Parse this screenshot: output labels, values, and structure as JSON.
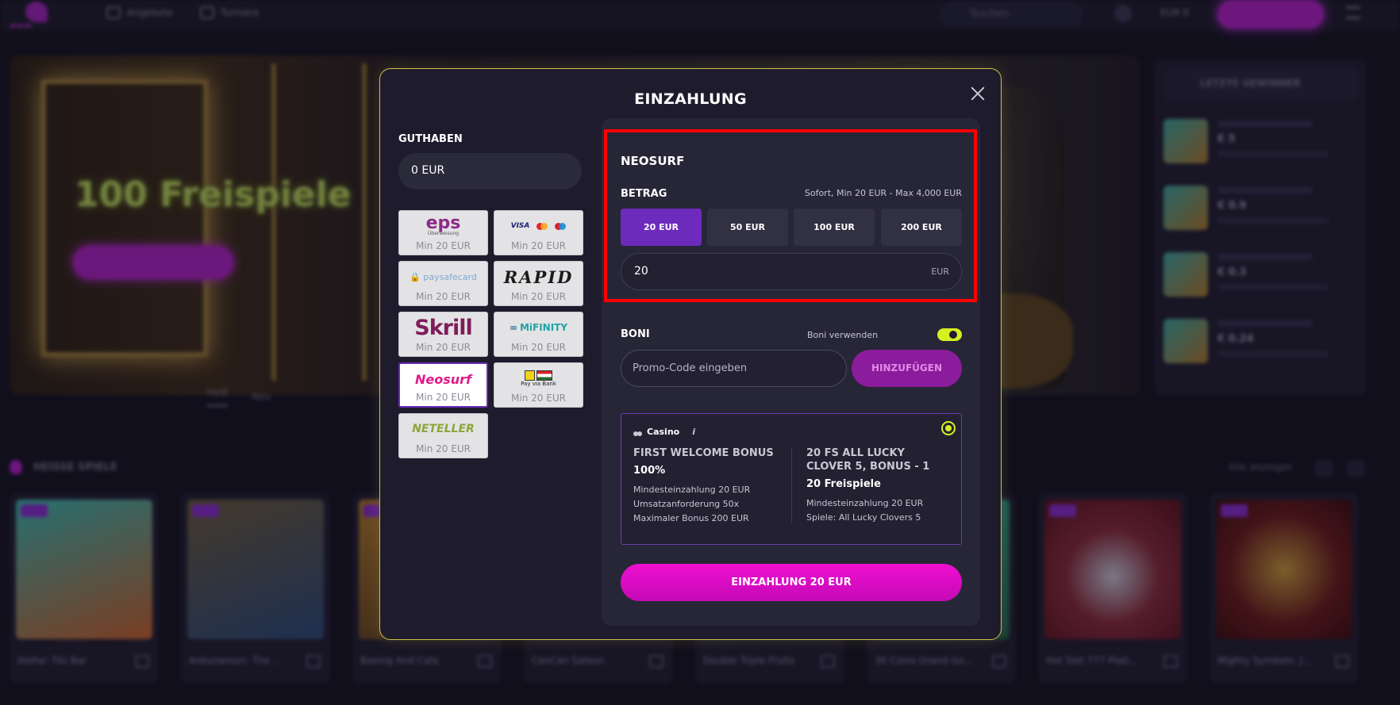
{
  "background": {
    "nav": {
      "offers": "Angebote",
      "tournaments": "Turniere"
    },
    "search_placeholder": "Suchen",
    "balance": "EUR 0",
    "hero_title": "100 Freispiele",
    "hero_tabs": [
      "Heiß",
      "Neu"
    ],
    "winners_title": "LETZTE GEWINNER",
    "winners": [
      "€ 5",
      "€ 0.9",
      "€ 0.3",
      "€ 0.24"
    ],
    "hot_games_title": "HEISSE SPIELE",
    "show_all": "Alle anzeigen",
    "games": [
      "Aloha! Tiki Bar",
      "Ankunamun: The ...",
      "Boxing And Cats",
      "CanCan Saloon",
      "Double Triple Fruits",
      "30 Coins Grand Go...",
      "Hot Slot 777 Plati...",
      "Mighty Symbols: J..."
    ]
  },
  "modal": {
    "title": "EINZAHLUNG",
    "balance_label": "GUTHABEN",
    "balance_value": "0 EUR",
    "methods": [
      {
        "name": "eps",
        "min": "Min 20 EUR"
      },
      {
        "name": "Visa Mastercard Maestro",
        "min": "Min 20 EUR"
      },
      {
        "name": "paysafecard",
        "min": "Min 20 EUR"
      },
      {
        "name": "RAPID",
        "min": "Min 20 EUR"
      },
      {
        "name": "Skrill",
        "min": "Min 20 EUR"
      },
      {
        "name": "MiFINITY",
        "min": "Min 20 EUR"
      },
      {
        "name": "Neosurf",
        "min": "Min 20 EUR",
        "selected": true
      },
      {
        "name": "Pay via Bank",
        "min": "Min 20 EUR"
      },
      {
        "name": "NETELLER",
        "min": "Min 20 EUR"
      }
    ],
    "selected_method_title": "NEOSURF",
    "amount_label": "BETRAG",
    "amount_info": "Sofort, Min 20 EUR - Max 4,000 EUR",
    "amount_options": [
      "20 EUR",
      "50 EUR",
      "100 EUR",
      "200 EUR"
    ],
    "amount_value": "20",
    "amount_currency": "EUR",
    "bonus_label": "BONI",
    "bonus_toggle_label": "Boni verwenden",
    "bonus_toggle_on": true,
    "promo_placeholder": "Promo-Code eingeben",
    "add_button": "HINZUFÜGEN",
    "bonus_card": {
      "category": "Casino",
      "info": "i",
      "left": {
        "name": "FIRST WELCOME BONUS",
        "value": "100%",
        "lines": [
          "Mindesteinzahlung 20 EUR",
          "Umsatzanforderung 50x",
          "Maximaler Bonus 200 EUR"
        ]
      },
      "right": {
        "name": "20 FS ALL LUCKY CLOVER 5, BONUS - 1",
        "value": "20 Freispiele",
        "lines": [
          "Mindesteinzahlung 20 EUR",
          "Spiele: All Lucky Clovers 5"
        ]
      }
    },
    "deposit_button": "EINZAHLUNG 20 EUR"
  },
  "colors": {
    "accent_purple": "#6d2bbd",
    "cta_magenta": "#ef10cf",
    "toggle_lime": "#d6ef21",
    "highlight_red": "#ff0000"
  }
}
